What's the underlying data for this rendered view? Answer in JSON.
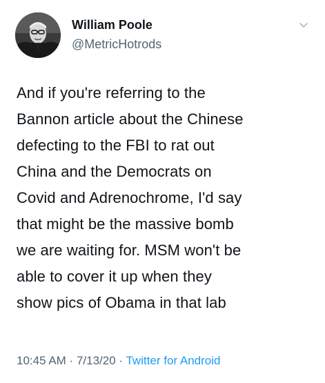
{
  "user": {
    "display_name": "William Poole",
    "handle": "@MetricHotrods",
    "avatar_icon": "user-photo-avatar"
  },
  "menu_icon": "chevron-down-icon",
  "tweet": {
    "lines": [
      "And if you're referring to the",
      "Bannon article about the Chinese",
      "defecting to the FBI to rat out",
      "China and the Democrats on",
      "Covid and Adrenochrome, I'd say",
      "that might be the massive bomb",
      "we are waiting for. MSM won't be",
      "able to cover it up when they",
      "show pics of Obama in that lab"
    ]
  },
  "meta": {
    "time": "10:45 AM",
    "separator": " · ",
    "date": "7/13/20",
    "source": "Twitter for Android"
  },
  "colors": {
    "text": "#0f1419",
    "secondary": "#536471",
    "link": "#1d9bf0"
  }
}
